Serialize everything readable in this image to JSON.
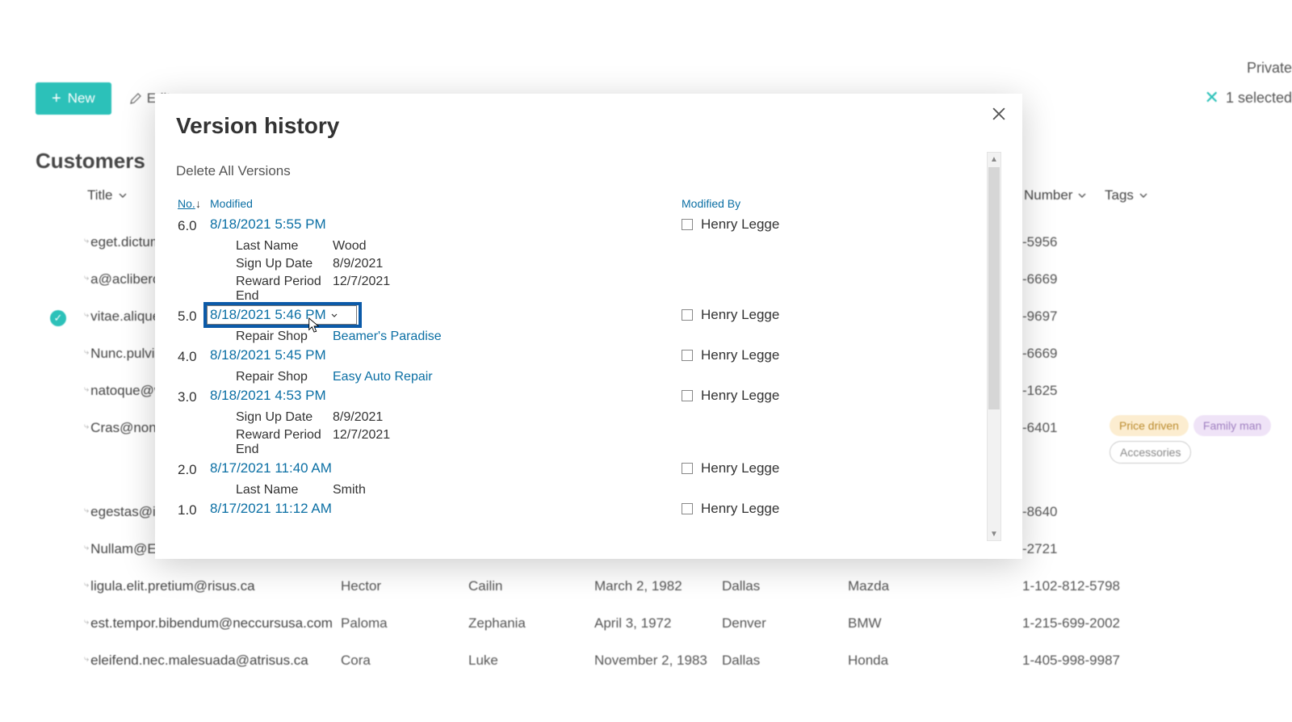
{
  "toolbar": {
    "new_label": "New",
    "edit_label": "Edit",
    "selected_label": "1 selected",
    "private_label": "Private"
  },
  "list": {
    "title": "Customers",
    "columns": {
      "title": "Title",
      "number": "Number",
      "tags": "Tags"
    },
    "rows": [
      {
        "title": "eget.dictum.p",
        "num": "-5956"
      },
      {
        "title": "a@aclibero.c",
        "num": "-6669"
      },
      {
        "title": "vitae.aliquet",
        "num": "-9697",
        "selected": true
      },
      {
        "title": "Nunc.pulvina",
        "num": "-6669"
      },
      {
        "title": "natoque@ve",
        "num": "-1625"
      },
      {
        "title": "Cras@non.co",
        "num": "-6401",
        "tags": [
          "Price driven",
          "Family man",
          "Accessories"
        ]
      },
      {
        "title": "egestas@in.e",
        "num": "-8640"
      },
      {
        "title": "Nullam@Etia",
        "num": "-2721"
      },
      {
        "title": "ligula.elit.pretium@risus.ca",
        "fn": "Hector",
        "mn": "Cailin",
        "dob": "March 2, 1982",
        "city": "Dallas",
        "make": "Mazda",
        "num": "1-102-812-5798"
      },
      {
        "title": "est.tempor.bibendum@neccursusa.com",
        "fn": "Paloma",
        "mn": "Zephania",
        "dob": "April 3, 1972",
        "city": "Denver",
        "make": "BMW",
        "num": "1-215-699-2002"
      },
      {
        "title": "eleifend.nec.malesuada@atrisus.ca",
        "fn": "Cora",
        "mn": "Luke",
        "dob": "November 2, 1983",
        "city": "Dallas",
        "make": "Honda",
        "num": "1-405-998-9987"
      }
    ]
  },
  "modal": {
    "title": "Version history",
    "delete_all": "Delete All Versions",
    "headers": {
      "no": "No.",
      "modified": "Modified",
      "modified_by": "Modified By"
    },
    "user": "Henry Legge",
    "versions": [
      {
        "no": "6.0",
        "date": "8/18/2021 5:55 PM",
        "by": "Henry Legge",
        "details": [
          {
            "k": "Last Name",
            "v": "Wood"
          },
          {
            "k": "Sign Up Date",
            "v": "8/9/2021"
          },
          {
            "k": "Reward Period End",
            "v": "12/7/2021"
          }
        ]
      },
      {
        "no": "5.0",
        "date": "8/18/2021 5:46 PM",
        "by": "Henry Legge",
        "highlighted": true,
        "details": [
          {
            "k": "Repair Shop",
            "v": "Beamer's Paradise",
            "link": true
          }
        ]
      },
      {
        "no": "4.0",
        "date": "8/18/2021 5:45 PM",
        "by": "Henry Legge",
        "details": [
          {
            "k": "Repair Shop",
            "v": "Easy Auto Repair",
            "link": true
          }
        ]
      },
      {
        "no": "3.0",
        "date": "8/18/2021 4:53 PM",
        "by": "Henry Legge",
        "details": [
          {
            "k": "Sign Up Date",
            "v": "8/9/2021"
          },
          {
            "k": "Reward Period End",
            "v": "12/7/2021"
          }
        ]
      },
      {
        "no": "2.0",
        "date": "8/17/2021 11:40 AM",
        "by": "Henry Legge",
        "details": [
          {
            "k": "Last Name",
            "v": "Smith"
          }
        ]
      },
      {
        "no": "1.0",
        "date": "8/17/2021 11:12 AM",
        "by": "Henry Legge"
      }
    ]
  }
}
